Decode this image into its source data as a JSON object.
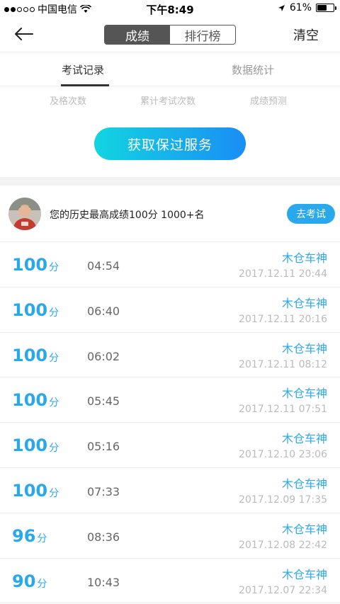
{
  "status_bar": {
    "carrier": "中国电信",
    "time": "下午8:49",
    "battery": "61%",
    "battery_level": 0.61,
    "signal_dots": [
      true,
      true,
      false,
      false,
      false
    ]
  },
  "nav": {
    "segments": [
      "成绩",
      "排行榜"
    ],
    "active_segment": 0,
    "clear_label": "清空"
  },
  "tabs": [
    "考试记录",
    "数据统计"
  ],
  "stats_labels": [
    "及格次数",
    "累计考试次数",
    "成绩预测"
  ],
  "cta_label": "获取保过服务",
  "best": {
    "text": "您的历史最高成绩100分  1000+名",
    "button": "去考试"
  },
  "score_unit": "分",
  "records": [
    {
      "score": "100",
      "duration": "04:54",
      "rank": "木仓车神",
      "datetime": "2017.12.11 20:44"
    },
    {
      "score": "100",
      "duration": "06:40",
      "rank": "木仓车神",
      "datetime": "2017.12.11 20:16"
    },
    {
      "score": "100",
      "duration": "06:02",
      "rank": "木仓车神",
      "datetime": "2017.12.11 08:12"
    },
    {
      "score": "100",
      "duration": "05:45",
      "rank": "木仓车神",
      "datetime": "2017.12.11 07:51"
    },
    {
      "score": "100",
      "duration": "05:16",
      "rank": "木仓车神",
      "datetime": "2017.12.10 23:06"
    },
    {
      "score": "100",
      "duration": "07:33",
      "rank": "木仓车神",
      "datetime": "2017.12.09 17:35"
    },
    {
      "score": "96",
      "duration": "08:36",
      "rank": "木仓车神",
      "datetime": "2017.12.08 22:42"
    },
    {
      "score": "90",
      "duration": "10:43",
      "rank": "木仓车神",
      "datetime": "2017.12.07 22:34"
    }
  ],
  "colors": {
    "accent": "#29a9eb",
    "cta_start": "#12d5e0",
    "cta_end": "#1a8ef5"
  }
}
